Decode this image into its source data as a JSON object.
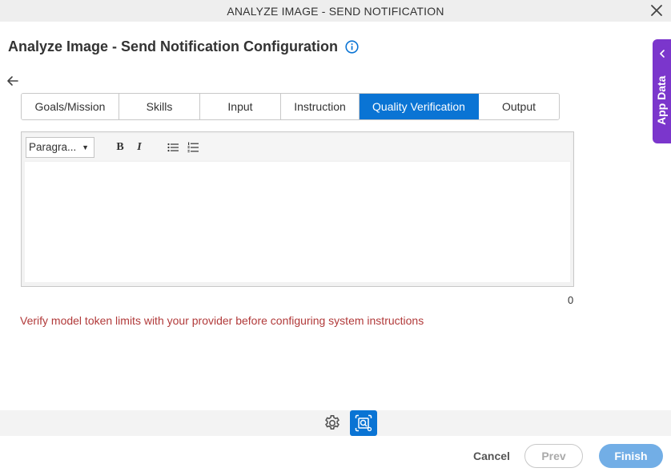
{
  "window": {
    "title": "ANALYZE IMAGE - SEND NOTIFICATION",
    "close_icon": "close-icon"
  },
  "heading": {
    "title": "Analyze Image - Send Notification Configuration",
    "info_icon": "info-icon"
  },
  "back_icon": "arrow-left-icon",
  "tabs": [
    {
      "label": "Goals/Mission",
      "active": false
    },
    {
      "label": "Skills",
      "active": false
    },
    {
      "label": "Input",
      "active": false
    },
    {
      "label": "Instruction",
      "active": false
    },
    {
      "label": "Quality Verification",
      "active": true
    },
    {
      "label": "Output",
      "active": false
    }
  ],
  "editor": {
    "format_value": "Paragra...",
    "bold_label": "B",
    "italic_label": "I",
    "content": "",
    "char_count": "0"
  },
  "warning": "Verify model token limits with your provider before configuring system instructions",
  "footer": {
    "cancel_label": "Cancel",
    "prev_label": "Prev",
    "finish_label": "Finish"
  },
  "side_panel": {
    "label": "App Data"
  },
  "colors": {
    "accent": "#0a74d4",
    "side_panel": "#7b36cc",
    "warning": "#b13a3a",
    "finish_disabled": "#72aee6"
  }
}
